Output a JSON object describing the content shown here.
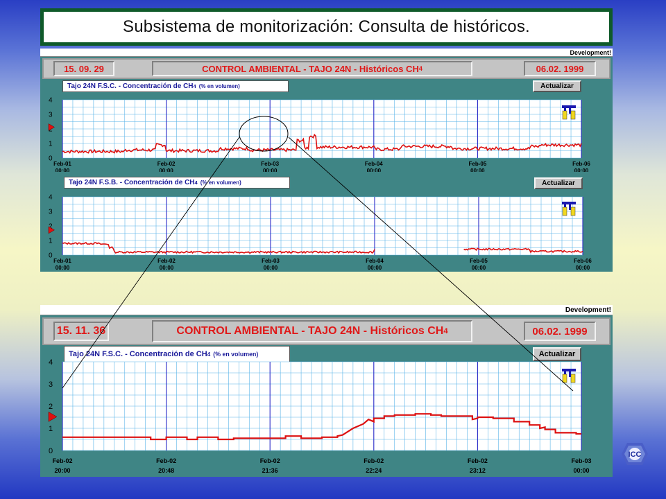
{
  "slide": {
    "title": "Subsistema de monitorización: Consulta de históricos."
  },
  "top_screen": {
    "dev_label": "Development!",
    "time": "15. 09. 29",
    "header_title": "CONTROL AMBIENTAL - TAJO 24N - Históricos CH",
    "header_sub": "4",
    "date": "06.02. 1999",
    "charts": [
      {
        "title_prefix": "Tajo 24N F.S.C. - Concentración de  CH",
        "title_sub": "4",
        "title_suffix": "(% en volumen)",
        "button": "Actualizar",
        "y_ticks": [
          "4",
          "3",
          "2",
          "1",
          "0"
        ],
        "x_dates": [
          "Feb-01",
          "Feb-02",
          "Feb-03",
          "Feb-04",
          "Feb-05",
          "Feb-06"
        ],
        "x_times": [
          "00:00",
          "00:00",
          "00:00",
          "00:00",
          "00:00",
          "00:00"
        ]
      },
      {
        "title_prefix": "Tajo 24N F.S.B. - Concentración de  CH",
        "title_sub": "4",
        "title_suffix": "(% en volumen)",
        "button": "Actualizar",
        "y_ticks": [
          "4",
          "3",
          "2",
          "1",
          "0"
        ],
        "x_dates": [
          "Feb-01",
          "Feb-02",
          "Feb-03",
          "Feb-04",
          "Feb-05",
          "Feb-06"
        ],
        "x_times": [
          "00:00",
          "00:00",
          "00:00",
          "00:00",
          "00:00",
          "00:00"
        ]
      }
    ]
  },
  "bottom_screen": {
    "dev_label": "Development!",
    "time": "15. 11. 36",
    "header_title": "CONTROL AMBIENTAL - TAJO 24N - Históricos CH",
    "header_sub": "4",
    "date": "06.02. 1999",
    "chart": {
      "title_prefix": "Tajo 24N F.S.C. - Concentración de  CH",
      "title_sub": "4",
      "title_suffix": "(% en volumen)",
      "button": "Actualizar",
      "y_ticks": [
        "4",
        "3",
        "2",
        "1",
        "0"
      ],
      "x_dates": [
        "Feb-02",
        "Feb-02",
        "Feb-02",
        "Feb-02",
        "Feb-02",
        "Feb-03"
      ],
      "x_times": [
        "20:00",
        "20:48",
        "21:36",
        "22:24",
        "23:12",
        "00:00"
      ]
    }
  },
  "colors": {
    "plot_line": "#dd1111",
    "grid_minor": "#5ab4e8",
    "grid_major": "#2a2ac8",
    "panel_bg": "#3f8585",
    "header_text": "#e01818"
  },
  "logo_text": "ICC"
}
